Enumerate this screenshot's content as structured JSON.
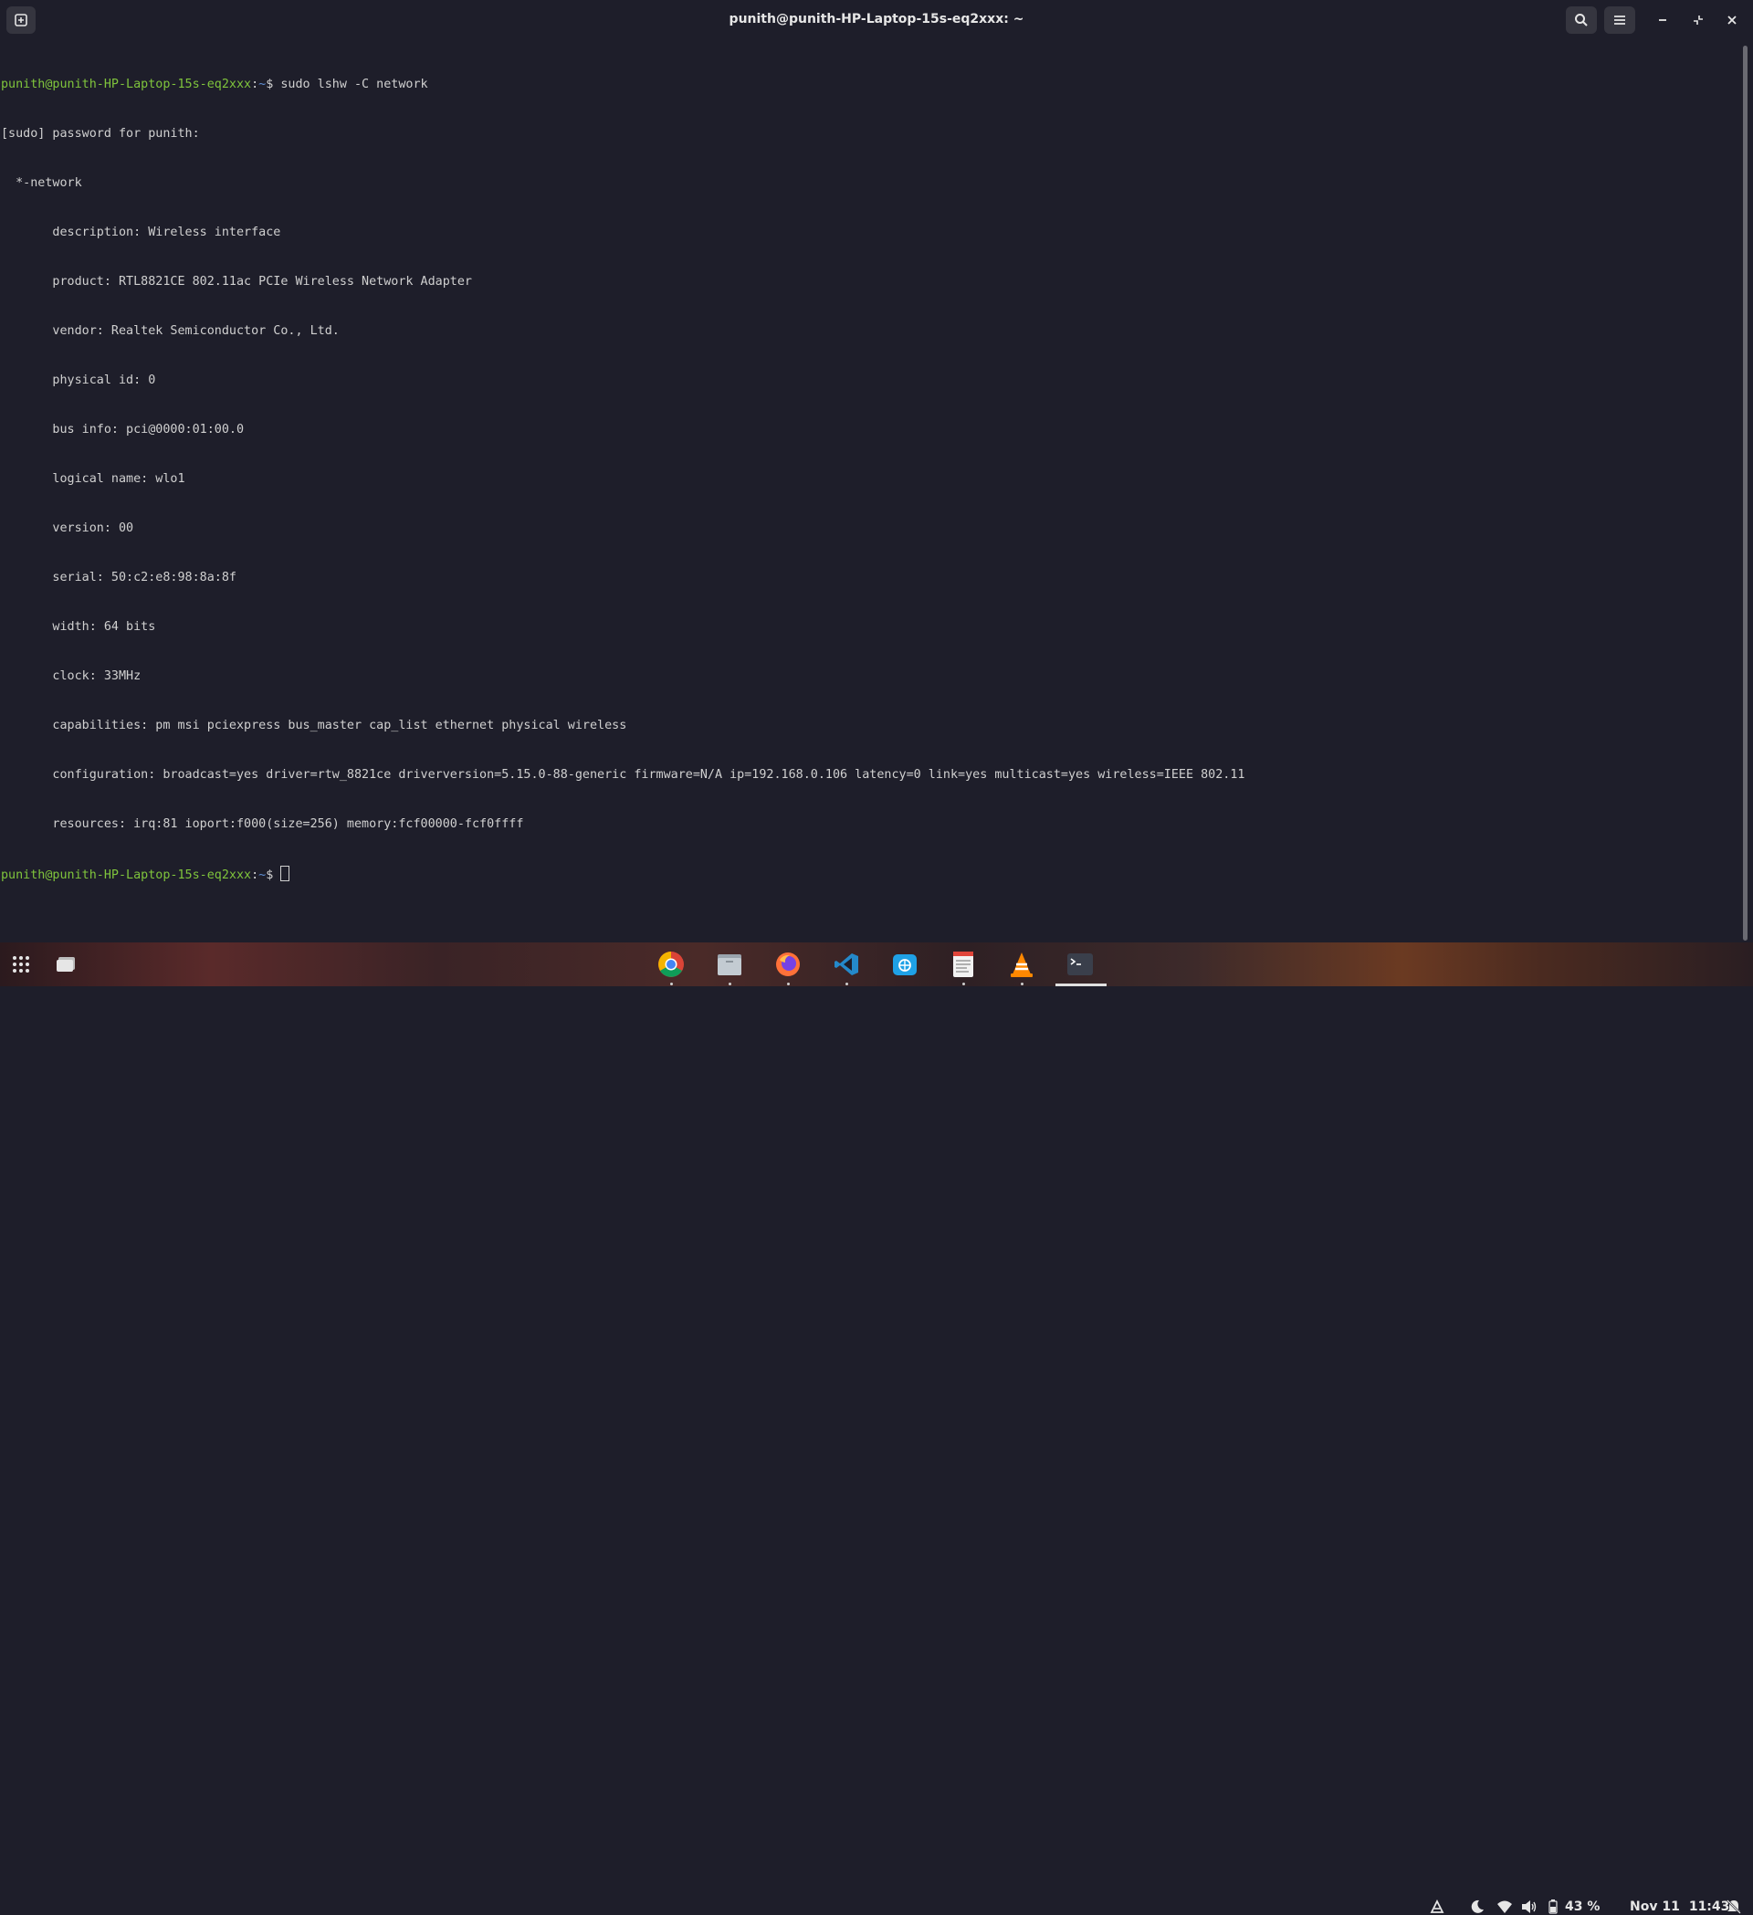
{
  "window": {
    "title": "punith@punith-HP-Laptop-15s-eq2xxx: ~"
  },
  "terminal": {
    "prompt": {
      "user_host": "punith@punith-HP-Laptop-15s-eq2xxx",
      "dir": "~",
      "symbol": "$"
    },
    "command": "sudo lshw -C network",
    "output": [
      "[sudo] password for punith:",
      "  *-network",
      "       description: Wireless interface",
      "       product: RTL8821CE 802.11ac PCIe Wireless Network Adapter",
      "       vendor: Realtek Semiconductor Co., Ltd.",
      "       physical id: 0",
      "       bus info: pci@0000:01:00.0",
      "       logical name: wlo1",
      "       version: 00",
      "       serial: 50:c2:e8:98:8a:8f",
      "       width: 64 bits",
      "       clock: 33MHz",
      "       capabilities: pm msi pciexpress bus_master cap_list ethernet physical wireless",
      "       configuration: broadcast=yes driver=rtw_8821ce driverversion=5.15.0-88-generic firmware=N/A ip=192.168.0.106 latency=0 link=yes multicast=yes wireless=IEEE 802.11",
      "       resources: irq:81 ioport:f000(size=256) memory:fcf00000-fcf0ffff"
    ]
  },
  "taskbar": {
    "apps": [
      {
        "name": "chrome-icon"
      },
      {
        "name": "files-icon"
      },
      {
        "name": "firefox-icon"
      },
      {
        "name": "vscode-icon"
      },
      {
        "name": "browser-icon"
      },
      {
        "name": "text-editor-icon"
      },
      {
        "name": "vlc-icon"
      },
      {
        "name": "terminal-icon"
      }
    ],
    "battery": "43 %",
    "date": "Nov 11",
    "time": "11:43"
  },
  "colors": {
    "background": "#1e1e2a",
    "prompt_user": "#7fc43c",
    "prompt_dir": "#5f8fd5",
    "text": "#d0d0d0"
  }
}
